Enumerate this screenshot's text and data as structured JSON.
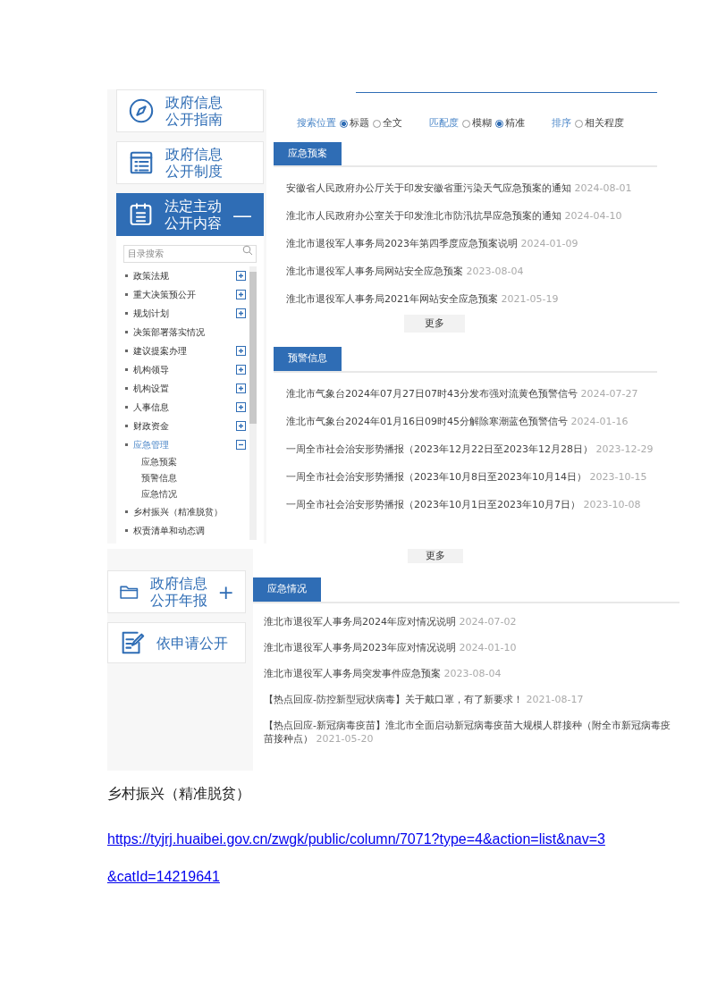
{
  "screenshot_1": {
    "sidebar": {
      "cards": [
        {
          "kind": "compass",
          "lines": [
            "政府信息",
            "公开指南"
          ],
          "active": false
        },
        {
          "kind": "list",
          "lines": [
            "政府信息",
            "公开制度"
          ],
          "active": false
        },
        {
          "kind": "clipboard",
          "lines": [
            "法定主动",
            "公开内容"
          ],
          "active": true,
          "toggle": "—"
        }
      ],
      "search": {
        "placeholder": "目录搜索"
      },
      "tree": [
        {
          "label": "政策法规",
          "selected": false,
          "expanded": false
        },
        {
          "label": "重大决策预公开",
          "selected": false,
          "expanded": false
        },
        {
          "label": "规划计划",
          "selected": false,
          "expanded": false
        },
        {
          "label": "决策部署落实情况",
          "selected": false
        },
        {
          "label": "建议提案办理",
          "selected": false,
          "expanded": false
        },
        {
          "label": "机构领导",
          "selected": false,
          "expanded": false
        },
        {
          "label": "机构设置",
          "selected": false,
          "expanded": false
        },
        {
          "label": "人事信息",
          "selected": false,
          "expanded": false
        },
        {
          "label": "财政资金",
          "selected": false,
          "expanded": false
        },
        {
          "label": "应急管理",
          "selected": true,
          "expanded": true,
          "children": [
            {
              "label": "应急预案"
            },
            {
              "label": "预警信息"
            },
            {
              "label": "应急情况"
            }
          ]
        },
        {
          "label": "乡村振兴（精准脱贫）",
          "selected": false
        },
        {
          "label": "权责清单和动态调",
          "selected": false
        }
      ]
    },
    "filters": [
      {
        "label": "搜索位置",
        "options": [
          {
            "label": "标题",
            "selected": true
          },
          {
            "label": "全文",
            "selected": false
          }
        ]
      },
      {
        "label": "匹配度",
        "options": [
          {
            "label": "模糊",
            "selected": false
          },
          {
            "label": "精准",
            "selected": true
          }
        ]
      },
      {
        "label": "排序",
        "options": [
          {
            "label": "相关程度",
            "selected": false
          }
        ]
      }
    ],
    "sections": [
      {
        "title": "应急预案",
        "more": "更多",
        "items": [
          {
            "title": "安徽省人民政府办公厅关于印发安徽省重污染天气应急预案的通知",
            "date": "2024-08-01"
          },
          {
            "title": "淮北市人民政府办公室关于印发淮北市防汛抗旱应急预案的通知",
            "date": "2024-04-10"
          },
          {
            "title": "淮北市退役军人事务局2023年第四季度应急预案说明",
            "date": "2024-01-09"
          },
          {
            "title": "淮北市退役军人事务局网站安全应急预案",
            "date": "2023-08-04"
          },
          {
            "title": "淮北市退役军人事务局2021年网站安全应急预案",
            "date": "2021-05-19"
          }
        ]
      },
      {
        "title": "预警信息",
        "items": [
          {
            "title": "淮北市气象台2024年07月27日07时43分发布强对流黄色预警信号",
            "date": "2024-07-27"
          },
          {
            "title": "淮北市气象台2024年01月16日09时45分解除寒潮蓝色预警信号",
            "date": "2024-01-16"
          },
          {
            "title": "一周全市社会治安形势播报（2023年12月22日至2023年12月28日）",
            "date": "2023-12-29"
          },
          {
            "title": "一周全市社会治安形势播报（2023年10月8日至2023年10月14日）",
            "date": "2023-10-15"
          },
          {
            "title": "一周全市社会治安形势播报（2023年10月1日至2023年10月7日）",
            "date": "2023-10-08"
          }
        ]
      }
    ]
  },
  "screenshot_2": {
    "sidebar": {
      "cards": [
        {
          "kind": "folder",
          "lines": [
            "政府信息",
            "公开年报"
          ],
          "active": false,
          "toggle": "+"
        },
        {
          "kind": "edit",
          "lines": [
            "依申请公开"
          ],
          "active": false
        }
      ]
    },
    "more_top": "更多",
    "section": {
      "title": "应急情况",
      "items": [
        {
          "title": "淮北市退役军人事务局2024年应对情况说明",
          "date": "2024-07-02"
        },
        {
          "title": "淮北市退役军人事务局2023年应对情况说明",
          "date": "2024-01-10"
        },
        {
          "title": "淮北市退役军人事务局突发事件应急预案",
          "date": "2023-08-04"
        },
        {
          "title": "【热点回应-防控新型冠状病毒】关于戴口罩，有了新要求！",
          "date": "2021-08-17"
        },
        {
          "title": "【热点回应-新冠病毒疫苗】淮北市全面启动新冠病毒疫苗大规模人群接种（附全市新冠病毒疫苗接种点）",
          "date": "2021-05-20"
        }
      ]
    }
  },
  "document": {
    "heading": "乡村振兴（精准脱贫）",
    "link": "https://tyjrj.huaibei.gov.cn/zwgk/public/column/7071?type=4&action=list&nav=3&catId=14219641"
  }
}
